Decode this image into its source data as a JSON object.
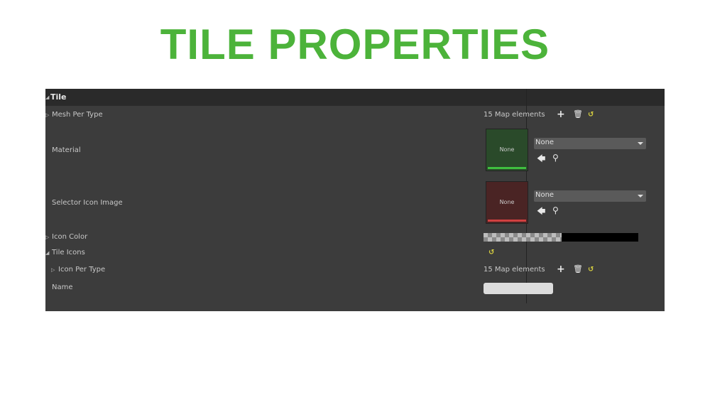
{
  "title": "TILE PROPERTIES",
  "panel": {
    "category": "Tile",
    "rows": {
      "mesh_per_type": {
        "label": "Mesh Per Type",
        "value": "15 Map elements"
      },
      "material": {
        "label": "Material",
        "thumb_text": "None",
        "combo_value": "None",
        "accent": "#3fbf3f"
      },
      "selector_icon_image": {
        "label": "Selector Icon Image",
        "thumb_text": "None",
        "combo_value": "None",
        "accent": "#d04040"
      },
      "icon_color": {
        "label": "Icon Color",
        "color": "#000000"
      },
      "tile_icons": {
        "label": "Tile Icons"
      },
      "icon_per_type": {
        "label": "Icon Per Type",
        "value": "15 Map elements"
      },
      "name": {
        "label": "Name",
        "value": ""
      }
    },
    "icons": {
      "add": "+",
      "delete": "🗑",
      "reset": "↺",
      "use_selected": "🡄",
      "browse": "⚲",
      "expand": "▷",
      "collapse": "◢"
    }
  }
}
